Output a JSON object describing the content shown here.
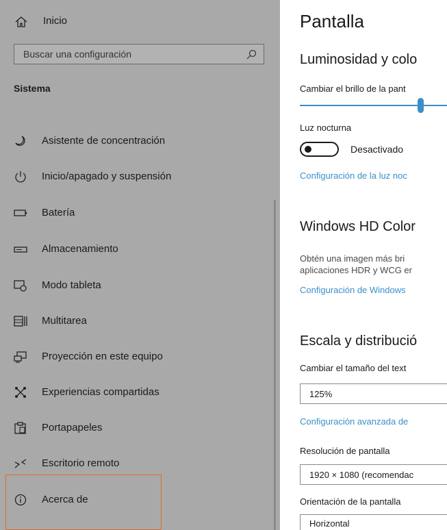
{
  "sidebar": {
    "home_label": "Inicio",
    "search_placeholder": "Buscar una configuración",
    "section_title": "Sistema",
    "items": [
      {
        "label": "Asistente de concentración",
        "icon": "moon-icon"
      },
      {
        "label": "Inicio/apagado y suspensión",
        "icon": "power-icon"
      },
      {
        "label": "Batería",
        "icon": "battery-icon"
      },
      {
        "label": "Almacenamiento",
        "icon": "storage-icon"
      },
      {
        "label": "Modo tableta",
        "icon": "tablet-mode-icon"
      },
      {
        "label": "Multitarea",
        "icon": "multitask-icon"
      },
      {
        "label": "Proyección en este equipo",
        "icon": "projection-icon"
      },
      {
        "label": "Experiencias compartidas",
        "icon": "shared-experiences-icon"
      },
      {
        "label": "Portapapeles",
        "icon": "clipboard-icon"
      },
      {
        "label": "Escritorio remoto",
        "icon": "remote-desktop-icon"
      },
      {
        "label": "Acerca de",
        "icon": "info-icon"
      }
    ],
    "highlight_color": "#e06a2c"
  },
  "main": {
    "page_title": "Pantalla",
    "brightness_heading": "Luminosidad y colo",
    "brightness_label": "Cambiar el brillo de la pant",
    "brightness_level_percent": 82,
    "night_light_label": "Luz nocturna",
    "night_light_state": "Desactivado",
    "night_light_link": "Configuración de la luz noc",
    "hd_color_heading": "Windows HD Color",
    "hd_color_desc_line1": "Obtén una imagen más bri",
    "hd_color_desc_line2": "aplicaciones HDR y WCG er",
    "hd_color_link": "Configuración de Windows",
    "scale_heading": "Escala y distribució",
    "scale_label": "Cambiar el tamaño del text",
    "scale_value": "125%",
    "scale_link": "Configuración avanzada de",
    "resolution_label": "Resolución de pantalla",
    "resolution_value": "1920 × 1080 (recomendac",
    "orientation_label": "Orientación de la pantalla",
    "orientation_value": "Horizontal"
  },
  "colors": {
    "sidebar_bg": "#a9a9a9",
    "accent": "#3b8fc9"
  }
}
